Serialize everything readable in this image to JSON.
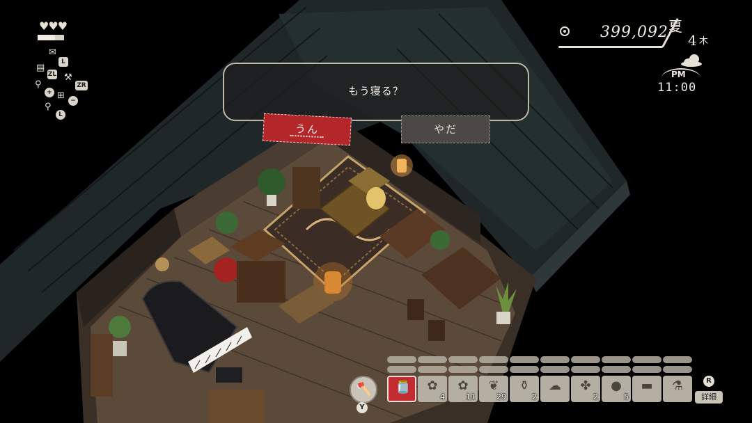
{
  "hud": {
    "hearts": "♥♥♥",
    "stamina_fraction": 0.65,
    "shortcuts": [
      {
        "icon": "map-icon",
        "button": "L"
      },
      {
        "icon": "journal-icon",
        "button": "ZL"
      },
      {
        "icon": "axe-icon",
        "button": "ZR"
      },
      {
        "icon": "location-pin-icon",
        "button": "+"
      },
      {
        "icon": "basket-icon",
        "button": "−"
      },
      {
        "icon": "magnifier-icon",
        "button": "L"
      }
    ],
    "money": "399,092",
    "season": "夏",
    "day": "4",
    "weekday": "木",
    "weather": "cloudy-icon",
    "ampm": "PM",
    "time": "11:00"
  },
  "dialog": {
    "question": "もう寝る？",
    "yes": "うん",
    "no": "やだ"
  },
  "toolbar": {
    "tool_icon": "axe-icon",
    "tool_button": "Y",
    "detail_button": "R",
    "detail_label": "詳細",
    "items": [
      {
        "icon": "jar-icon",
        "count": "",
        "selected": true
      },
      {
        "icon": "flower-bundle-icon",
        "count": "4"
      },
      {
        "icon": "flower-bundle-icon",
        "count": "11"
      },
      {
        "icon": "herb-icon",
        "count": "29"
      },
      {
        "icon": "bottle-icon",
        "count": "2"
      },
      {
        "icon": "cotton-icon",
        "count": ""
      },
      {
        "icon": "root-icon",
        "count": "2"
      },
      {
        "icon": "olive-icon",
        "count": "5"
      },
      {
        "icon": "log-icon",
        "count": ""
      },
      {
        "icon": "sake-bottle-icon",
        "count": ""
      }
    ]
  },
  "colors": {
    "accent_red": "#b3262a",
    "hud_text": "#f0ece4",
    "slot_bg": "#b5aea2"
  }
}
